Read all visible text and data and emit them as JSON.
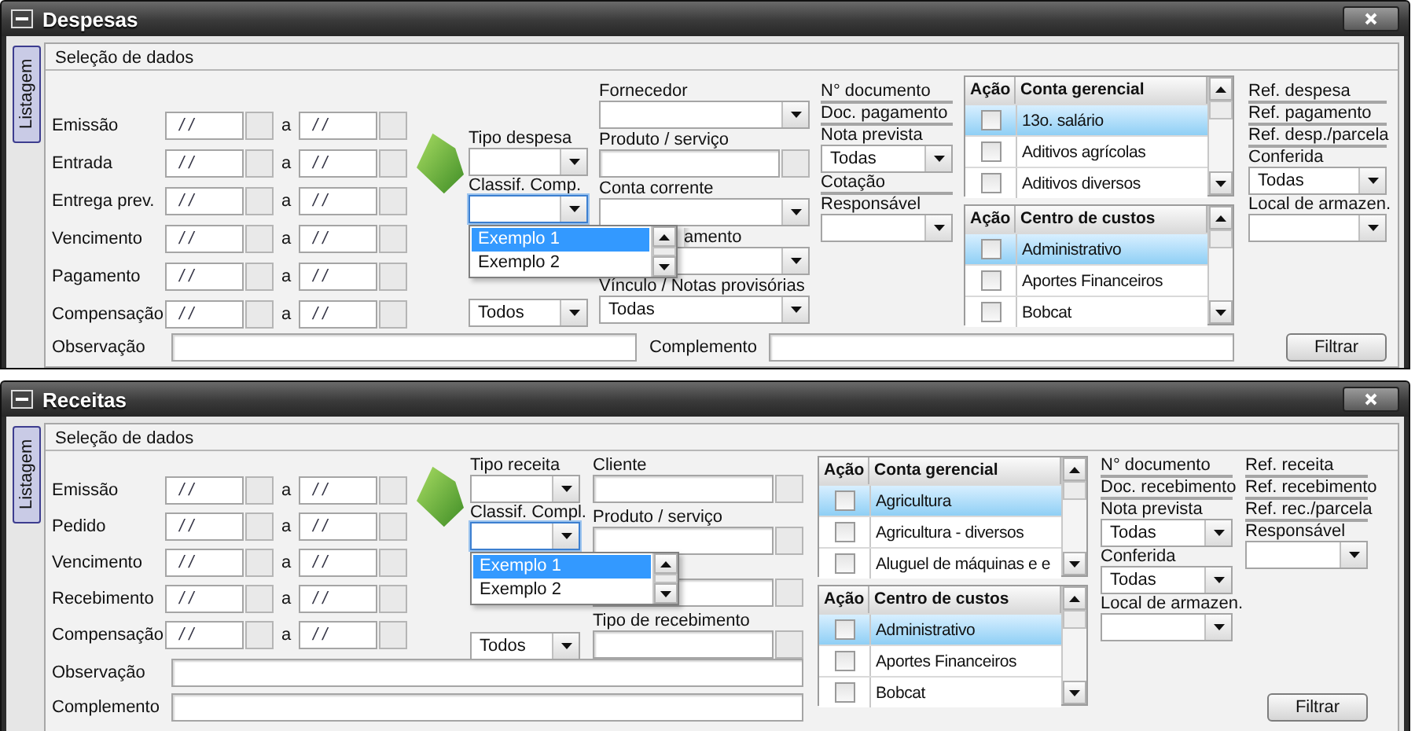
{
  "windows": [
    {
      "title": "Despesas",
      "side_tab": "Listagem",
      "section_title": "Seleção de dados",
      "main_columns": [
        {
          "kind": "dates",
          "rows": [
            {
              "label": "Emissão",
              "from": "/ /",
              "separator": "a",
              "to": "/ /"
            },
            {
              "label": "Entrada",
              "from": "/ /",
              "separator": "a",
              "to": "/ /"
            },
            {
              "label": "Entrega prev.",
              "from": "/ /",
              "separator": "a",
              "to": "/ /"
            },
            {
              "label": "Vencimento",
              "from": "/ /",
              "separator": "a",
              "to": "/ /"
            },
            {
              "label": "Pagamento",
              "from": "/ /",
              "separator": "a",
              "to": "/ /"
            },
            {
              "label": "Compensação",
              "from": "/ /",
              "separator": "a",
              "to": "/ /"
            }
          ]
        },
        {
          "kind": "fields",
          "fields": [
            {
              "kind": "combo",
              "label": "Tipo despesa"
            },
            {
              "kind": "combo",
              "label": "Classif. Comp.",
              "expanded": true,
              "options": [
                {
                  "label": "Exemplo 1",
                  "selected": true
                },
                {
                  "label": "Exemplo 2",
                  "selected": false
                }
              ]
            },
            {
              "kind": "combo",
              "value": "Todos"
            }
          ]
        },
        {
          "kind": "fields",
          "fields": [
            {
              "kind": "combo",
              "label": "Fornecedor"
            },
            {
              "kind": "text_button",
              "label": "Produto / serviço"
            },
            {
              "kind": "combo",
              "label": "Conta corrente"
            },
            {
              "kind": "combo",
              "label": "amento",
              "clipped": true
            },
            {
              "kind": "combo",
              "label": "Vínculo / Notas provisórias",
              "value": "Todas"
            }
          ]
        },
        {
          "kind": "fields",
          "fields": [
            {
              "kind": "text",
              "label": "N° documento"
            },
            {
              "kind": "text",
              "label": "Doc. pagamento"
            },
            {
              "kind": "combo",
              "label": "Nota prevista",
              "value": "Todas"
            },
            {
              "kind": "text",
              "label": "Cotação"
            },
            {
              "kind": "combo",
              "label": "Responsável"
            }
          ]
        },
        {
          "kind": "tables",
          "tables": [
            {
              "headers": [
                "Ação",
                "Conta gerencial"
              ],
              "rows": [
                {
                  "label": "13o. salário",
                  "selected": true,
                  "checked": false
                },
                {
                  "label": "Aditivos agrícolas",
                  "selected": false,
                  "checked": false
                },
                {
                  "label": "Aditivos diversos",
                  "selected": false,
                  "checked": false
                }
              ]
            },
            {
              "headers": [
                "Ação",
                "Centro de custos"
              ],
              "rows": [
                {
                  "label": "Administrativo",
                  "selected": true,
                  "checked": false
                },
                {
                  "label": "Aportes Financeiros",
                  "selected": false,
                  "checked": false
                },
                {
                  "label": "Bobcat",
                  "selected": false,
                  "checked": false
                }
              ]
            }
          ]
        }
      ],
      "footer": [
        [
          {
            "label": "Observação"
          },
          {
            "label": "Complemento"
          }
        ]
      ],
      "side_columns": [
        {
          "kind": "fields",
          "fields": [
            {
              "kind": "text",
              "label": "Ref. despesa"
            },
            {
              "kind": "text",
              "label": "Ref. pagamento"
            },
            {
              "kind": "text",
              "label": "Ref. desp./parcela"
            },
            {
              "kind": "combo",
              "label": "Conferida",
              "value": "Todas"
            },
            {
              "kind": "combo",
              "label": "Local de armazen."
            },
            {
              "kind": "button",
              "label": "Filtrar"
            }
          ]
        }
      ]
    },
    {
      "title": "Receitas",
      "side_tab": "Listagem",
      "section_title": "Seleção de dados",
      "main_columns": [
        {
          "kind": "dates",
          "rows": [
            {
              "label": "Emissão",
              "from": "/ /",
              "separator": "a",
              "to": "/ /"
            },
            {
              "label": "Pedido",
              "from": "/ /",
              "separator": "a",
              "to": "/ /"
            },
            {
              "label": "Vencimento",
              "from": "/ /",
              "separator": "a",
              "to": "/ /"
            },
            {
              "label": "Recebimento",
              "from": "/ /",
              "separator": "a",
              "to": "/ /"
            },
            {
              "label": "Compensação",
              "from": "/ /",
              "separator": "a",
              "to": "/ /"
            }
          ]
        },
        {
          "kind": "fields",
          "fields": [
            {
              "kind": "combo",
              "label": "Tipo receita"
            },
            {
              "kind": "combo",
              "label": "Classif. Compl.",
              "expanded": true,
              "options": [
                {
                  "label": "Exemplo 1",
                  "selected": true
                },
                {
                  "label": "Exemplo 2",
                  "selected": false
                }
              ]
            },
            {
              "kind": "combo",
              "value": "Todos"
            }
          ]
        },
        {
          "kind": "fields",
          "fields": [
            {
              "kind": "text_button",
              "label": "Cliente"
            },
            {
              "kind": "text_button",
              "label": "Produto / serviço"
            },
            {
              "kind": "text_button"
            },
            {
              "kind": "text_button",
              "label": "Tipo de recebimento"
            }
          ]
        }
      ],
      "footer": [
        [
          {
            "label": "Observação"
          }
        ],
        [
          {
            "label": "Complemento"
          }
        ]
      ],
      "side_columns": [
        {
          "kind": "tables",
          "tables": [
            {
              "headers": [
                "Ação",
                "Conta gerencial"
              ],
              "rows": [
                {
                  "label": "Agricultura",
                  "selected": true,
                  "checked": false
                },
                {
                  "label": "Agricultura - diversos",
                  "selected": false,
                  "checked": false
                },
                {
                  "label": "Aluguel de máquinas e e",
                  "selected": false,
                  "checked": false
                }
              ]
            },
            {
              "headers": [
                "Ação",
                "Centro de custos"
              ],
              "rows": [
                {
                  "label": "Administrativo",
                  "selected": true,
                  "checked": false
                },
                {
                  "label": "Aportes Financeiros",
                  "selected": false,
                  "checked": false
                },
                {
                  "label": "Bobcat",
                  "selected": false,
                  "checked": false
                }
              ]
            }
          ]
        },
        {
          "kind": "fields",
          "fields": [
            {
              "kind": "text",
              "label": "N° documento"
            },
            {
              "kind": "text",
              "label": "Doc. recebimento"
            },
            {
              "kind": "combo",
              "label": "Nota prevista",
              "value": "Todas"
            },
            {
              "kind": "combo",
              "label": "Conferida",
              "value": "Todas"
            },
            {
              "kind": "combo",
              "label": "Local de armazen."
            }
          ]
        },
        {
          "kind": "fields",
          "fields": [
            {
              "kind": "text",
              "label": "Ref. receita"
            },
            {
              "kind": "text",
              "label": "Ref. recebimento"
            },
            {
              "kind": "text",
              "label": "Ref. rec./parcela"
            },
            {
              "kind": "combo",
              "label": "Responsável"
            },
            {
              "kind": "button",
              "label": "Filtrar"
            }
          ]
        }
      ]
    }
  ]
}
